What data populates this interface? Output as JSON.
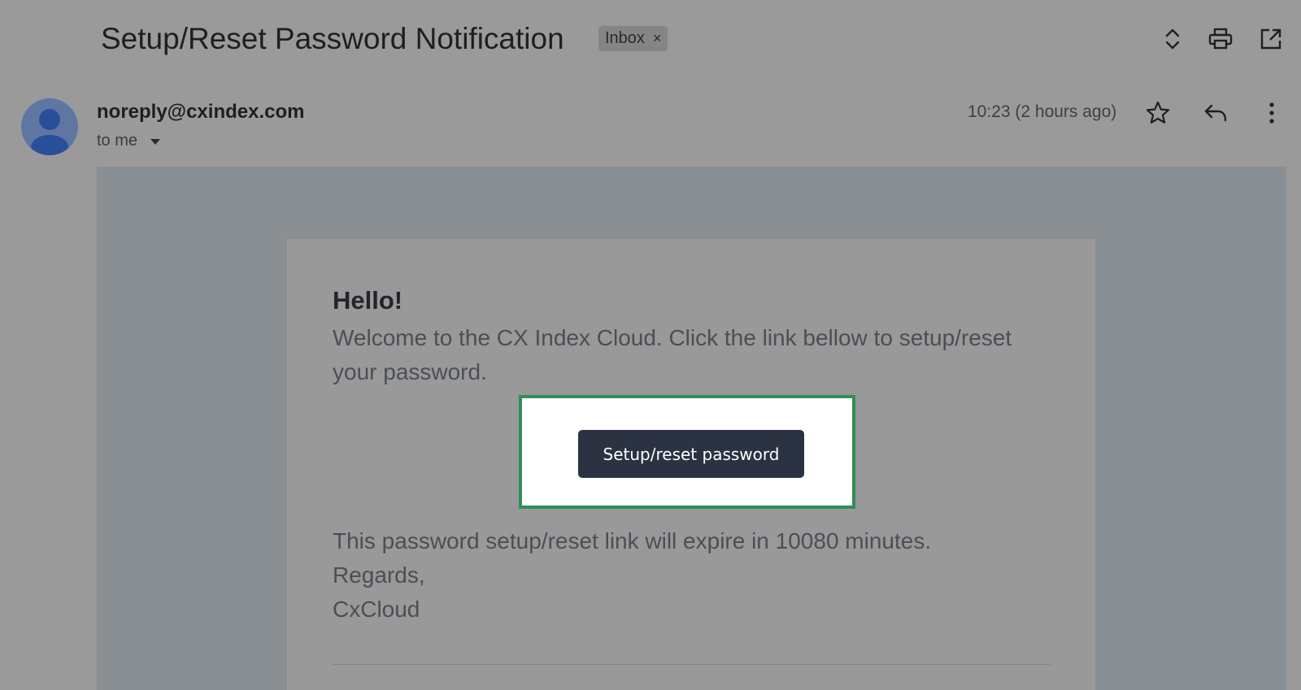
{
  "email": {
    "subject": "Setup/Reset Password Notification",
    "label": "Inbox",
    "label_remove": "×",
    "sender": "noreply@cxindex.com",
    "recipient": "to me",
    "timestamp": "10:23 (2 hours ago)"
  },
  "toolbar": {
    "icons": [
      "expand-collapse-icon",
      "print-icon",
      "open-in-new-window-icon"
    ]
  },
  "message_actions": {
    "icons": [
      "star-icon",
      "reply-icon",
      "more-options-icon"
    ]
  },
  "body": {
    "greeting": "Hello!",
    "intro": "Welcome to the CX Index Cloud. Click the link bellow to setup/reset your password.",
    "button_label": "Setup/reset password",
    "expiry": "This password setup/reset link will expire in 10080 minutes.",
    "closing": "Regards,",
    "signature": "CxCloud"
  },
  "colors": {
    "highlight_border": "#2f8f57",
    "button_bg": "#2b3242"
  }
}
